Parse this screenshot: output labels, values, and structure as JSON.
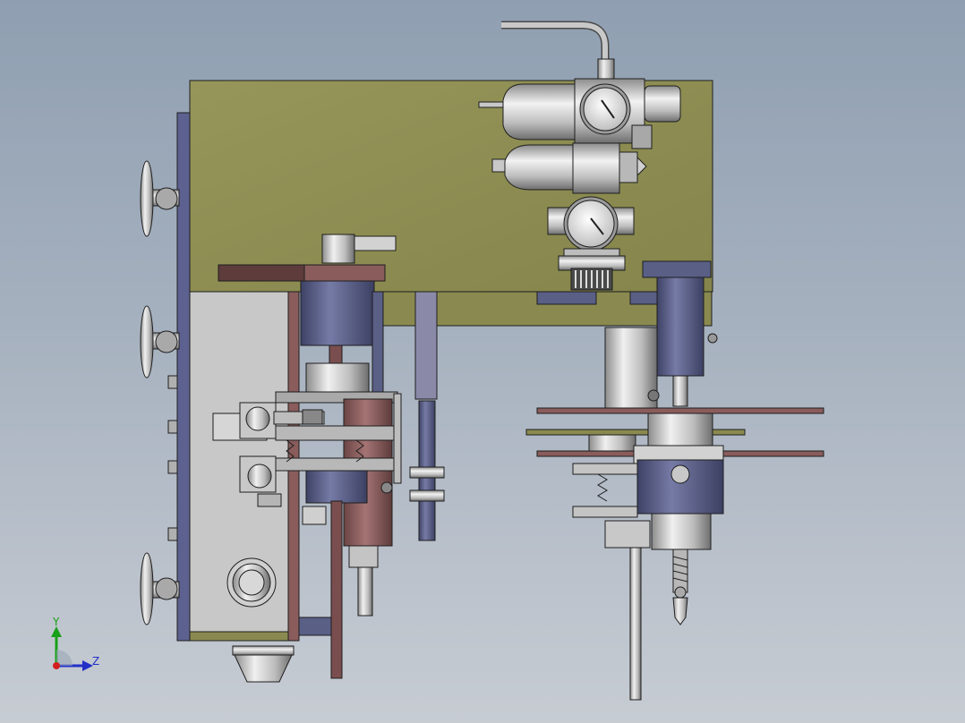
{
  "cad_view": {
    "background_colors": [
      "#8f9fb1",
      "#c7ccd3"
    ],
    "part_colors": {
      "panel": "#8f8f52",
      "steel": "#c0c0c0",
      "dark_blue": "#5a5f86",
      "brown": "#8a5c5c",
      "edge": "#1e1e1e"
    }
  },
  "triad": {
    "y_label": "Y",
    "z_label": "Z",
    "colors": {
      "y": "#18a018",
      "z": "#2230c8",
      "origin": "#d21e1e"
    }
  }
}
